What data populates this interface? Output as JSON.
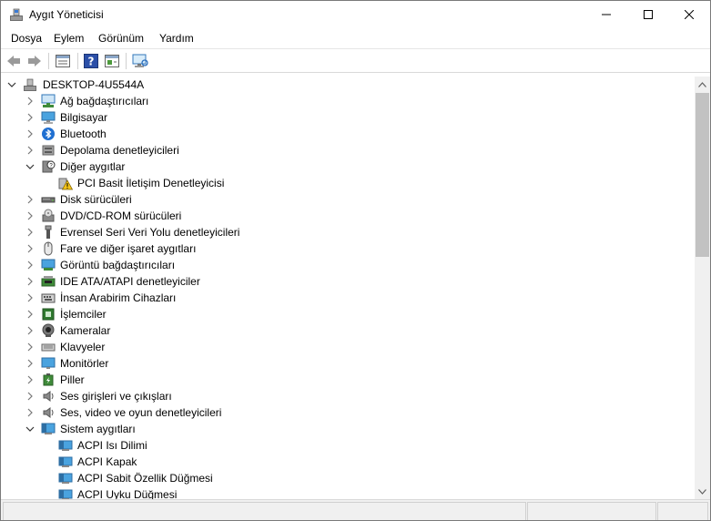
{
  "window": {
    "title": "Aygıt Yöneticisi"
  },
  "menu": {
    "items": [
      "Dosya",
      "Eylem",
      "Görünüm",
      "Yardım"
    ]
  },
  "toolbar": {
    "buttons": [
      "back-icon",
      "forward-icon",
      "properties-list-icon",
      "help-icon",
      "show-hidden-icon",
      "monitor-scan-icon"
    ]
  },
  "tree": {
    "root": "DESKTOP-4U5544A",
    "items": [
      {
        "label": "Ağ bağdaştırıcıları",
        "icon": "network-adapter-icon",
        "expanded": false,
        "level": 1
      },
      {
        "label": "Bilgisayar",
        "icon": "computer-icon",
        "expanded": false,
        "level": 1
      },
      {
        "label": "Bluetooth",
        "icon": "bluetooth-icon",
        "expanded": false,
        "level": 1
      },
      {
        "label": "Depolama denetleyicileri",
        "icon": "storage-controller-icon",
        "expanded": false,
        "level": 1
      },
      {
        "label": "Diğer aygıtlar",
        "icon": "other-devices-icon",
        "expanded": true,
        "level": 1
      },
      {
        "label": "PCI Basit İletişim Denetleyicisi",
        "icon": "warning-device-icon",
        "level": 2
      },
      {
        "label": "Disk sürücüleri",
        "icon": "disk-drive-icon",
        "expanded": false,
        "level": 1
      },
      {
        "label": "DVD/CD-ROM sürücüleri",
        "icon": "dvd-drive-icon",
        "expanded": false,
        "level": 1
      },
      {
        "label": "Evrensel Seri Veri Yolu denetleyicileri",
        "icon": "usb-icon",
        "expanded": false,
        "level": 1
      },
      {
        "label": "Fare ve diğer işaret aygıtları",
        "icon": "mouse-icon",
        "expanded": false,
        "level": 1
      },
      {
        "label": "Görüntü bağdaştırıcıları",
        "icon": "display-adapter-icon",
        "expanded": false,
        "level": 1
      },
      {
        "label": "IDE ATA/ATAPI denetleyiciler",
        "icon": "ide-controller-icon",
        "expanded": false,
        "level": 1
      },
      {
        "label": "İnsan Arabirim Cihazları",
        "icon": "hid-icon",
        "expanded": false,
        "level": 1
      },
      {
        "label": "İşlemciler",
        "icon": "processor-icon",
        "expanded": false,
        "level": 1
      },
      {
        "label": "Kameralar",
        "icon": "camera-icon",
        "expanded": false,
        "level": 1
      },
      {
        "label": "Klavyeler",
        "icon": "keyboard-icon",
        "expanded": false,
        "level": 1
      },
      {
        "label": "Monitörler",
        "icon": "monitor-icon",
        "expanded": false,
        "level": 1
      },
      {
        "label": "Piller",
        "icon": "battery-icon",
        "expanded": false,
        "level": 1
      },
      {
        "label": "Ses girişleri ve çıkışları",
        "icon": "speaker-icon",
        "expanded": false,
        "level": 1
      },
      {
        "label": "Ses, video ve oyun denetleyicileri",
        "icon": "sound-icon",
        "expanded": false,
        "level": 1
      },
      {
        "label": "Sistem aygıtları",
        "icon": "system-devices-icon",
        "expanded": true,
        "level": 1
      },
      {
        "label": "ACPI Isı Dilimi",
        "icon": "system-device-icon",
        "level": 2
      },
      {
        "label": "ACPI Kapak",
        "icon": "system-device-icon",
        "level": 2
      },
      {
        "label": "ACPI Sabit Özellik Düğmesi",
        "icon": "system-device-icon",
        "level": 2
      },
      {
        "label": "ACPI Uyku Düğmesi",
        "icon": "system-device-icon",
        "level": 2
      }
    ]
  }
}
